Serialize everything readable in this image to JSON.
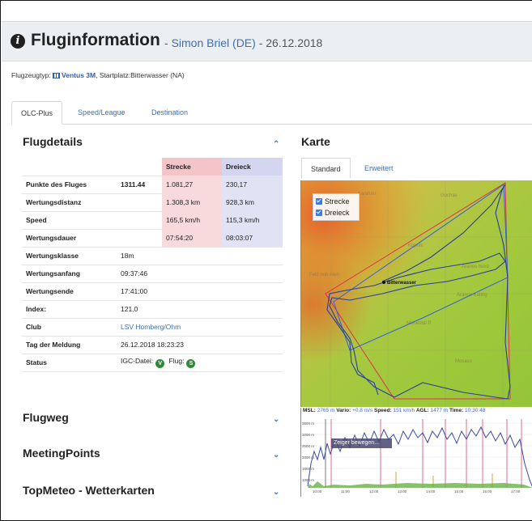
{
  "header": {
    "title": "Fluginformation",
    "pilot": "Simon Briel (DE)",
    "date": "26.12.2018"
  },
  "typebar": {
    "prefix": "Flugzeugtyp:",
    "glider": "Ventus 3M",
    "start": "Startplatz:Bitterwasser (NA)"
  },
  "tabs": [
    {
      "label": "OLC-Plus",
      "active": true
    },
    {
      "label": "Speed/League",
      "active": false
    },
    {
      "label": "Destination",
      "active": false
    }
  ],
  "flugdetails": {
    "title": "Flugdetails",
    "col_strecke": "Strecke",
    "col_dreieck": "Dreieck",
    "rows": [
      {
        "label": "Punkte des Fluges",
        "value": "1311.44",
        "strecke": "1.081,27",
        "dreieck": "230,17"
      },
      {
        "label": "Wertungsdistanz",
        "value": "",
        "strecke": "1.308,3 km",
        "dreieck": "928,3 km"
      },
      {
        "label": "Speed",
        "value": "",
        "strecke": "165,5 km/h",
        "dreieck": "115,3 km/h"
      },
      {
        "label": "Wertungsdauer",
        "value": "",
        "strecke": "07:54:20",
        "dreieck": "08:03:07"
      },
      {
        "label": "Wertungsklasse",
        "value": "18m"
      },
      {
        "label": "Wertungsanfang",
        "value": "09:37:46"
      },
      {
        "label": "Wertungsende",
        "value": "17:41:00"
      },
      {
        "label": "Index:",
        "value": "121,0"
      },
      {
        "label": "Club",
        "value": "LSV Homberg/Ohm"
      },
      {
        "label": "Tag der Meldung",
        "value": "26.12.2018 18:23:23"
      }
    ],
    "status": {
      "label": "Status",
      "igc": "IGC-Datei:",
      "igc_badge": "V",
      "flug": "Flug:",
      "flug_badge": "S"
    }
  },
  "karte": {
    "title": "Karte",
    "tab_standard": "Standard",
    "tab_erweitert": "Erweitert",
    "legend": [
      "Strecke",
      "Dreieck"
    ],
    "place": "Bitterwasser",
    "place_labels": [
      "Kalahari",
      "Gochas",
      "Kopnik",
      "Aranos Nord",
      "Aranos Kaltrig",
      "Mariental P",
      "Mosaso",
      "Feld nub Aleh"
    ],
    "colors": {
      "strecke": "#e0304a",
      "dreieck": "#3060e0",
      "track": "#2b3c9c"
    }
  },
  "barogram": {
    "msl_label": "MSL:",
    "msl": "2765 m",
    "vario_label": "Vario:",
    "vario": "+0.8 m/s",
    "speed_label": "Speed:",
    "speed": "151 km/h",
    "agl_label": "AGL:",
    "agl": "1477 m",
    "time_label": "Time:",
    "time": "10:30:48",
    "tooltip": "Zeiger bewegen...",
    "altitude_ticks": [
      "3500 m",
      "3000 m",
      "2500 m",
      "2000 m",
      "1500 m",
      "1000 m"
    ],
    "time_ticks": [
      "10:00",
      "11:00",
      "12:00",
      "13:00",
      "14:00",
      "15:00",
      "16:00",
      "17:00"
    ]
  },
  "sections": [
    {
      "title": "Flugweg"
    },
    {
      "title": "MeetingPoints"
    },
    {
      "title": "TopMeteo - Wetterkarten"
    }
  ]
}
